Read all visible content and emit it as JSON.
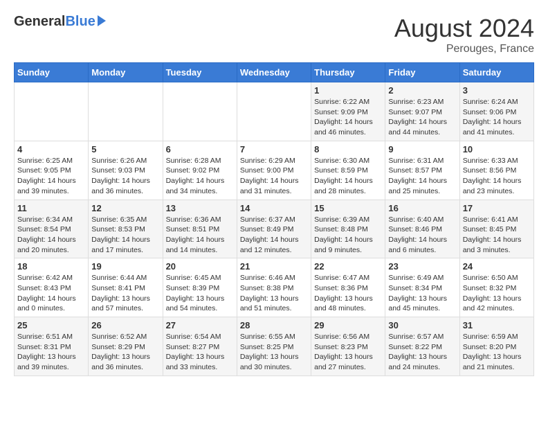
{
  "logo": {
    "general": "General",
    "blue": "Blue"
  },
  "title": "August 2024",
  "subtitle": "Perouges, France",
  "headers": [
    "Sunday",
    "Monday",
    "Tuesday",
    "Wednesday",
    "Thursday",
    "Friday",
    "Saturday"
  ],
  "weeks": [
    [
      {
        "day": "",
        "info": ""
      },
      {
        "day": "",
        "info": ""
      },
      {
        "day": "",
        "info": ""
      },
      {
        "day": "",
        "info": ""
      },
      {
        "day": "1",
        "info": "Sunrise: 6:22 AM\nSunset: 9:09 PM\nDaylight: 14 hours and 46 minutes."
      },
      {
        "day": "2",
        "info": "Sunrise: 6:23 AM\nSunset: 9:07 PM\nDaylight: 14 hours and 44 minutes."
      },
      {
        "day": "3",
        "info": "Sunrise: 6:24 AM\nSunset: 9:06 PM\nDaylight: 14 hours and 41 minutes."
      }
    ],
    [
      {
        "day": "4",
        "info": "Sunrise: 6:25 AM\nSunset: 9:05 PM\nDaylight: 14 hours and 39 minutes."
      },
      {
        "day": "5",
        "info": "Sunrise: 6:26 AM\nSunset: 9:03 PM\nDaylight: 14 hours and 36 minutes."
      },
      {
        "day": "6",
        "info": "Sunrise: 6:28 AM\nSunset: 9:02 PM\nDaylight: 14 hours and 34 minutes."
      },
      {
        "day": "7",
        "info": "Sunrise: 6:29 AM\nSunset: 9:00 PM\nDaylight: 14 hours and 31 minutes."
      },
      {
        "day": "8",
        "info": "Sunrise: 6:30 AM\nSunset: 8:59 PM\nDaylight: 14 hours and 28 minutes."
      },
      {
        "day": "9",
        "info": "Sunrise: 6:31 AM\nSunset: 8:57 PM\nDaylight: 14 hours and 25 minutes."
      },
      {
        "day": "10",
        "info": "Sunrise: 6:33 AM\nSunset: 8:56 PM\nDaylight: 14 hours and 23 minutes."
      }
    ],
    [
      {
        "day": "11",
        "info": "Sunrise: 6:34 AM\nSunset: 8:54 PM\nDaylight: 14 hours and 20 minutes."
      },
      {
        "day": "12",
        "info": "Sunrise: 6:35 AM\nSunset: 8:53 PM\nDaylight: 14 hours and 17 minutes."
      },
      {
        "day": "13",
        "info": "Sunrise: 6:36 AM\nSunset: 8:51 PM\nDaylight: 14 hours and 14 minutes."
      },
      {
        "day": "14",
        "info": "Sunrise: 6:37 AM\nSunset: 8:49 PM\nDaylight: 14 hours and 12 minutes."
      },
      {
        "day": "15",
        "info": "Sunrise: 6:39 AM\nSunset: 8:48 PM\nDaylight: 14 hours and 9 minutes."
      },
      {
        "day": "16",
        "info": "Sunrise: 6:40 AM\nSunset: 8:46 PM\nDaylight: 14 hours and 6 minutes."
      },
      {
        "day": "17",
        "info": "Sunrise: 6:41 AM\nSunset: 8:45 PM\nDaylight: 14 hours and 3 minutes."
      }
    ],
    [
      {
        "day": "18",
        "info": "Sunrise: 6:42 AM\nSunset: 8:43 PM\nDaylight: 14 hours and 0 minutes."
      },
      {
        "day": "19",
        "info": "Sunrise: 6:44 AM\nSunset: 8:41 PM\nDaylight: 13 hours and 57 minutes."
      },
      {
        "day": "20",
        "info": "Sunrise: 6:45 AM\nSunset: 8:39 PM\nDaylight: 13 hours and 54 minutes."
      },
      {
        "day": "21",
        "info": "Sunrise: 6:46 AM\nSunset: 8:38 PM\nDaylight: 13 hours and 51 minutes."
      },
      {
        "day": "22",
        "info": "Sunrise: 6:47 AM\nSunset: 8:36 PM\nDaylight: 13 hours and 48 minutes."
      },
      {
        "day": "23",
        "info": "Sunrise: 6:49 AM\nSunset: 8:34 PM\nDaylight: 13 hours and 45 minutes."
      },
      {
        "day": "24",
        "info": "Sunrise: 6:50 AM\nSunset: 8:32 PM\nDaylight: 13 hours and 42 minutes."
      }
    ],
    [
      {
        "day": "25",
        "info": "Sunrise: 6:51 AM\nSunset: 8:31 PM\nDaylight: 13 hours and 39 minutes."
      },
      {
        "day": "26",
        "info": "Sunrise: 6:52 AM\nSunset: 8:29 PM\nDaylight: 13 hours and 36 minutes."
      },
      {
        "day": "27",
        "info": "Sunrise: 6:54 AM\nSunset: 8:27 PM\nDaylight: 13 hours and 33 minutes."
      },
      {
        "day": "28",
        "info": "Sunrise: 6:55 AM\nSunset: 8:25 PM\nDaylight: 13 hours and 30 minutes."
      },
      {
        "day": "29",
        "info": "Sunrise: 6:56 AM\nSunset: 8:23 PM\nDaylight: 13 hours and 27 minutes."
      },
      {
        "day": "30",
        "info": "Sunrise: 6:57 AM\nSunset: 8:22 PM\nDaylight: 13 hours and 24 minutes."
      },
      {
        "day": "31",
        "info": "Sunrise: 6:59 AM\nSunset: 8:20 PM\nDaylight: 13 hours and 21 minutes."
      }
    ]
  ]
}
